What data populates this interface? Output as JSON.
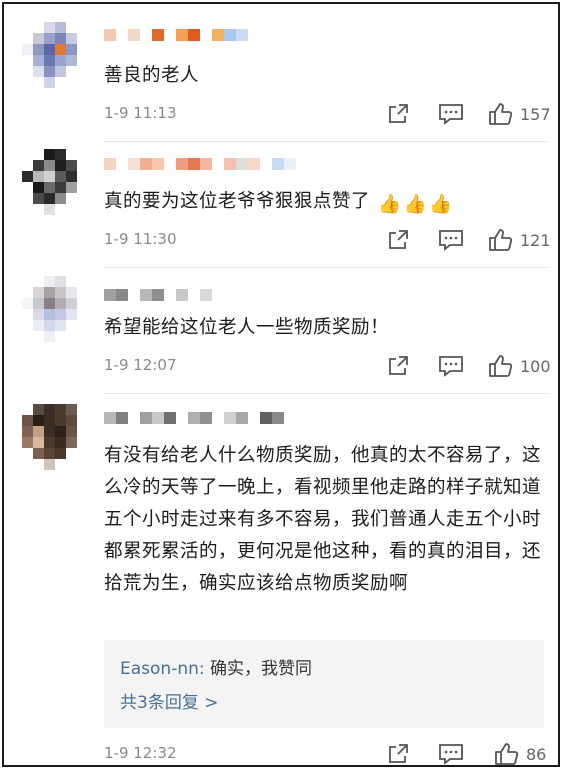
{
  "comments": [
    {
      "text": "善良的老人",
      "time": "1-9 11:13",
      "likes": "157",
      "avatar_colors": [
        "#ffffff",
        "#ffffff",
        "#d8d8e8",
        "#b8bcd4",
        "#ffffff",
        "#ffffff",
        "#ffffff",
        "#c8c8d8",
        "#9aa0c8",
        "#7d86b8",
        "#c6cce0",
        "#ffffff",
        "#f0f0f6",
        "#8e98c0",
        "#5a68a8",
        "#e07a3a",
        "#8c96c4",
        "#ffffff",
        "#ffffff",
        "#a8b0d4",
        "#6a78b4",
        "#9aa4cc",
        "#b0b8d8",
        "#ffffff",
        "#ffffff",
        "#dcdff0",
        "#8a92bc",
        "#c0c6e0",
        "#ffffff",
        "#ffffff",
        "#ffffff",
        "#ffffff",
        "#cfd3e8",
        "#ffffff",
        "#ffffff",
        "#ffffff"
      ],
      "username_colors": [
        "#f4c9b0",
        "#ffffff",
        "#f0d8c8",
        "#ffffff",
        "#e06a28",
        "#ffffff",
        "#f3a056",
        "#e05a20",
        "#ffffff",
        "#f2b060",
        "#a8c8f0",
        "#c8dcf4"
      ]
    },
    {
      "text": "真的要为这位老爷爷狠狠点赞了",
      "emoji": [
        "👍",
        "👍",
        "👍"
      ],
      "time": "1-9 11:30",
      "likes": "121",
      "avatar_colors": [
        "#ffffff",
        "#ffffff",
        "#1a1a1a",
        "#2a2a2a",
        "#ffffff",
        "#ffffff",
        "#ffffff",
        "#3a3a3a",
        "#8a8a8a",
        "#1e1e1e",
        "#4a4a4a",
        "#ffffff",
        "#2a2a2a",
        "#b8b8b8",
        "#d0d0d0",
        "#5a5a5a",
        "#2e2e2e",
        "#ffffff",
        "#ffffff",
        "#1a1a1a",
        "#6a6a6a",
        "#3c3c3c",
        "#a0a0a0",
        "#ffffff",
        "#ffffff",
        "#4a4a4a",
        "#2a2a2a",
        "#8c8c8c",
        "#ffffff",
        "#ffffff",
        "#ffffff",
        "#ffffff",
        "#e0e0e0",
        "#ffffff",
        "#ffffff",
        "#ffffff"
      ],
      "username_colors": [
        "#f6d4c4",
        "#ffffff",
        "#f8e0d4",
        "#f3b090",
        "#f6c8b0",
        "#ffffff",
        "#f0a080",
        "#e87850",
        "#f2b8a0",
        "#ffffff",
        "#f4c0b0",
        "#e0dcd8",
        "#f8d8c8",
        "#ffffff",
        "#c8dcf4",
        "#e8f0fa"
      ]
    },
    {
      "text": "希望能给这位老人一些物质奖励！",
      "time": "1-9 12:07",
      "likes": "100",
      "avatar_colors": [
        "#ffffff",
        "#ffffff",
        "#f0eef0",
        "#e0e0e4",
        "#ffffff",
        "#ffffff",
        "#ffffff",
        "#d8d4d8",
        "#a8a0a4",
        "#c8c4c8",
        "#e8e8ec",
        "#ffffff",
        "#f4f4f6",
        "#c8c8d0",
        "#8a8088",
        "#b4acb4",
        "#d0d0d8",
        "#ffffff",
        "#ffffff",
        "#dcd8e8",
        "#b8c0e0",
        "#c4c8e4",
        "#e4e4f0",
        "#ffffff",
        "#ffffff",
        "#eceef6",
        "#d4d8ec",
        "#e0e4f0",
        "#ffffff",
        "#ffffff",
        "#ffffff",
        "#ffffff",
        "#f0f0f4",
        "#ffffff",
        "#ffffff",
        "#ffffff"
      ],
      "username_colors": [
        "#a0a0a0",
        "#888888",
        "#ffffff",
        "#b8b8b8",
        "#909090",
        "#ffffff",
        "#c8c8c8",
        "#ffffff",
        "#d8d8d8"
      ]
    },
    {
      "text": "有没有给老人什么物质奖励，他真的太不容易了，这么冷的天等了一晚上，看视频里他走路的样子就知道五个小时走过来有多不容易，我们普通人走五个小时都累死累活的，更何况是他这种，看的真的泪目，还拾荒为生，确实应该给点物质奖励啊",
      "time": "1-9 12:32",
      "likes": "86",
      "avatar_colors": [
        "#ffffff",
        "#5a4a40",
        "#3a2e28",
        "#4a3a30",
        "#6a5a50",
        "#ffffff",
        "#6a5448",
        "#2a2018",
        "#3a2c22",
        "#4a3a2e",
        "#5c4a3e",
        "#ffffff",
        "#806050",
        "#c4a088",
        "#3c2e24",
        "#2e2218",
        "#6a5446",
        "#ffffff",
        "#9a7a66",
        "#d8b8a0",
        "#4a382c",
        "#3a2a20",
        "#806654",
        "#ffffff",
        "#ffffff",
        "#7a6050",
        "#5a4436",
        "#4a382a",
        "#ffffff",
        "#ffffff",
        "#ffffff",
        "#ffffff",
        "#d0c4bc",
        "#ffffff",
        "#ffffff",
        "#ffffff"
      ],
      "username_colors": [
        "#b8b8b8",
        "#808080",
        "#ffffff",
        "#a0a0a0",
        "#c8c8c8",
        "#707070",
        "#ffffff",
        "#b0b0b0",
        "#909090",
        "#ffffff",
        "#d0d0d0",
        "#a8a8a8",
        "#ffffff",
        "#606060",
        "#888888"
      ],
      "reply": {
        "author": "Eason-nn:",
        "text": "确实，我赞同",
        "more": "共3条回复 >"
      }
    }
  ],
  "icons": {
    "share": "share-icon",
    "reply": "comment-icon",
    "like": "thumbs-up-icon"
  }
}
